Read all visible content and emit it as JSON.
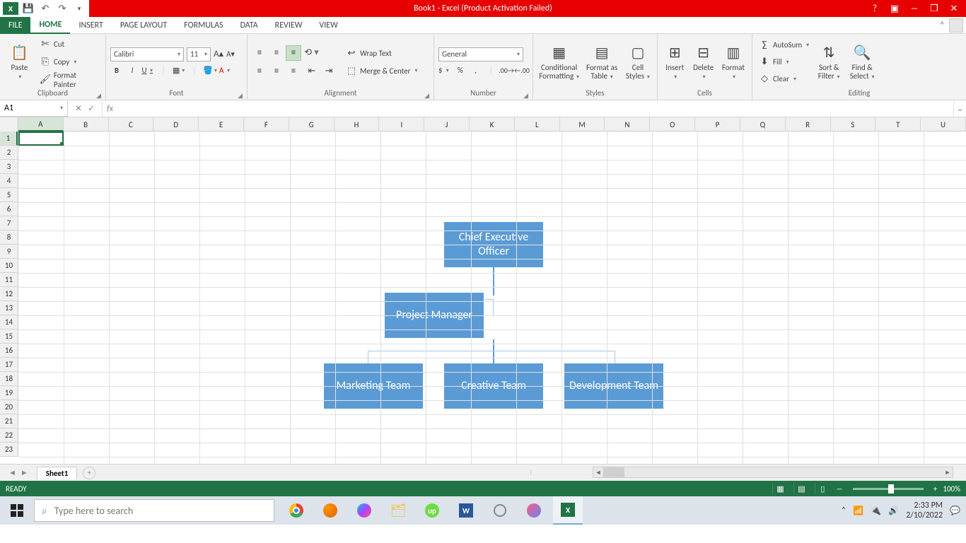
{
  "title": "Book1 - Excel (Product Activation Failed)",
  "tabs": {
    "file": "FILE",
    "home": "HOME",
    "insert": "INSERT",
    "pagelayout": "PAGE LAYOUT",
    "formulas": "FORMULAS",
    "data": "DATA",
    "review": "REVIEW",
    "view": "VIEW"
  },
  "ribbon": {
    "clipboard": {
      "paste": "Paste",
      "cut": "Cut",
      "copy": "Copy",
      "formatpainter": "Format Painter",
      "label": "Clipboard"
    },
    "font": {
      "name": "Calibri",
      "size": "11",
      "bold": "B",
      "italic": "I",
      "underline": "U",
      "label": "Font"
    },
    "alignment": {
      "wrap": "Wrap Text",
      "merge": "Merge & Center",
      "label": "Alignment"
    },
    "number": {
      "format": "General",
      "label": "Number"
    },
    "styles": {
      "cond": "Conditional Formatting",
      "table": "Format as Table",
      "cell": "Cell Styles",
      "label": "Styles"
    },
    "cells": {
      "insert": "Insert",
      "delete": "Delete",
      "format": "Format",
      "label": "Cells"
    },
    "editing": {
      "autosum": "AutoSum",
      "fill": "Fill",
      "clear": "Clear",
      "sort": "Sort & Filter",
      "find": "Find & Select",
      "label": "Editing"
    }
  },
  "namebox": "A1",
  "columns": [
    "A",
    "B",
    "C",
    "D",
    "E",
    "F",
    "G",
    "H",
    "I",
    "J",
    "K",
    "L",
    "M",
    "N",
    "O",
    "P",
    "Q",
    "R",
    "S",
    "T",
    "U"
  ],
  "rows": [
    "1",
    "2",
    "3",
    "4",
    "5",
    "6",
    "7",
    "8",
    "9",
    "10",
    "11",
    "12",
    "13",
    "14",
    "15",
    "16",
    "17",
    "18",
    "19",
    "20",
    "21",
    "22",
    "23"
  ],
  "org": {
    "ceo": "Chief Executive Officer",
    "pm": "Project Manager",
    "mkt": "Marketing Team",
    "cre": "Creative Team",
    "dev": "Development Team"
  },
  "sheet": {
    "name": "Sheet1"
  },
  "status": {
    "ready": "READY",
    "zoom": "100%"
  },
  "taskbar": {
    "search": "Type here to search",
    "time": "2:33 PM",
    "date": "2/10/2022"
  }
}
